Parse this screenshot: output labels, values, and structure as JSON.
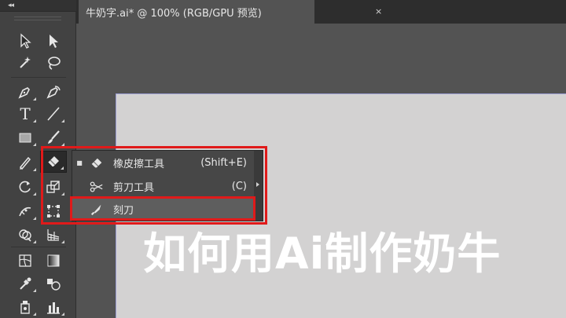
{
  "toolbar": {
    "collapse_label": "◂◂",
    "tools": [
      {
        "name": "selection-tool",
        "icon": "arrow-icon"
      },
      {
        "name": "direct-selection-tool",
        "icon": "white-arrow-icon"
      },
      {
        "name": "magic-wand-tool",
        "icon": "magic-wand-icon"
      },
      {
        "name": "lasso-tool",
        "icon": "lasso-icon"
      },
      {
        "name": "pen-tool",
        "icon": "pen-icon"
      },
      {
        "name": "curvature-tool",
        "icon": "curvature-icon"
      },
      {
        "name": "type-tool",
        "icon": "type-icon",
        "glyph": "T"
      },
      {
        "name": "line-segment-tool",
        "icon": "line-icon"
      },
      {
        "name": "rectangle-tool",
        "icon": "rectangle-icon"
      },
      {
        "name": "paintbrush-tool",
        "icon": "brush-icon"
      },
      {
        "name": "pencil-tool",
        "icon": "pencil-icon"
      },
      {
        "name": "eraser-tool",
        "icon": "eraser-icon",
        "selected": true
      },
      {
        "name": "rotate-tool",
        "icon": "rotate-icon"
      },
      {
        "name": "scale-tool",
        "icon": "scale-icon"
      },
      {
        "name": "width-tool",
        "icon": "width-icon"
      },
      {
        "name": "free-transform-tool",
        "icon": "free-transform-icon"
      },
      {
        "name": "shape-builder-tool",
        "icon": "shape-builder-icon"
      },
      {
        "name": "chart-tool",
        "icon": "column-chart-icon"
      },
      {
        "name": "mesh-tool",
        "icon": "mesh-icon"
      },
      {
        "name": "gradient-tool",
        "icon": "gradient-icon"
      },
      {
        "name": "eyedropper-tool",
        "icon": "eyedropper-icon"
      },
      {
        "name": "blend-tool",
        "icon": "blend-icon"
      },
      {
        "name": "symbol-sprayer-tool",
        "icon": "symbol-sprayer-icon"
      },
      {
        "name": "column-graph-tool",
        "icon": "bar-graph-icon"
      }
    ]
  },
  "document_tab": {
    "title": "牛奶字.ai* @ 100% (RGB/GPU 预览)",
    "close_label": "×"
  },
  "flyout": {
    "items": [
      {
        "label": "橡皮擦工具",
        "shortcut": "(Shift+E)",
        "icon": "eraser-icon",
        "active": true,
        "bullet": "■"
      },
      {
        "label": "剪刀工具",
        "shortcut": "(C)",
        "icon": "scissors-icon",
        "active": false,
        "bullet": ""
      },
      {
        "label": "刻刀",
        "shortcut": "",
        "icon": "knife-icon",
        "active": false,
        "bullet": ""
      }
    ]
  },
  "overlay": {
    "title": "如何用Ai制作奶牛"
  },
  "colors": {
    "highlight_box": "#e01a1a",
    "artboard": "#d3d2d2",
    "canvas": "#535353"
  }
}
